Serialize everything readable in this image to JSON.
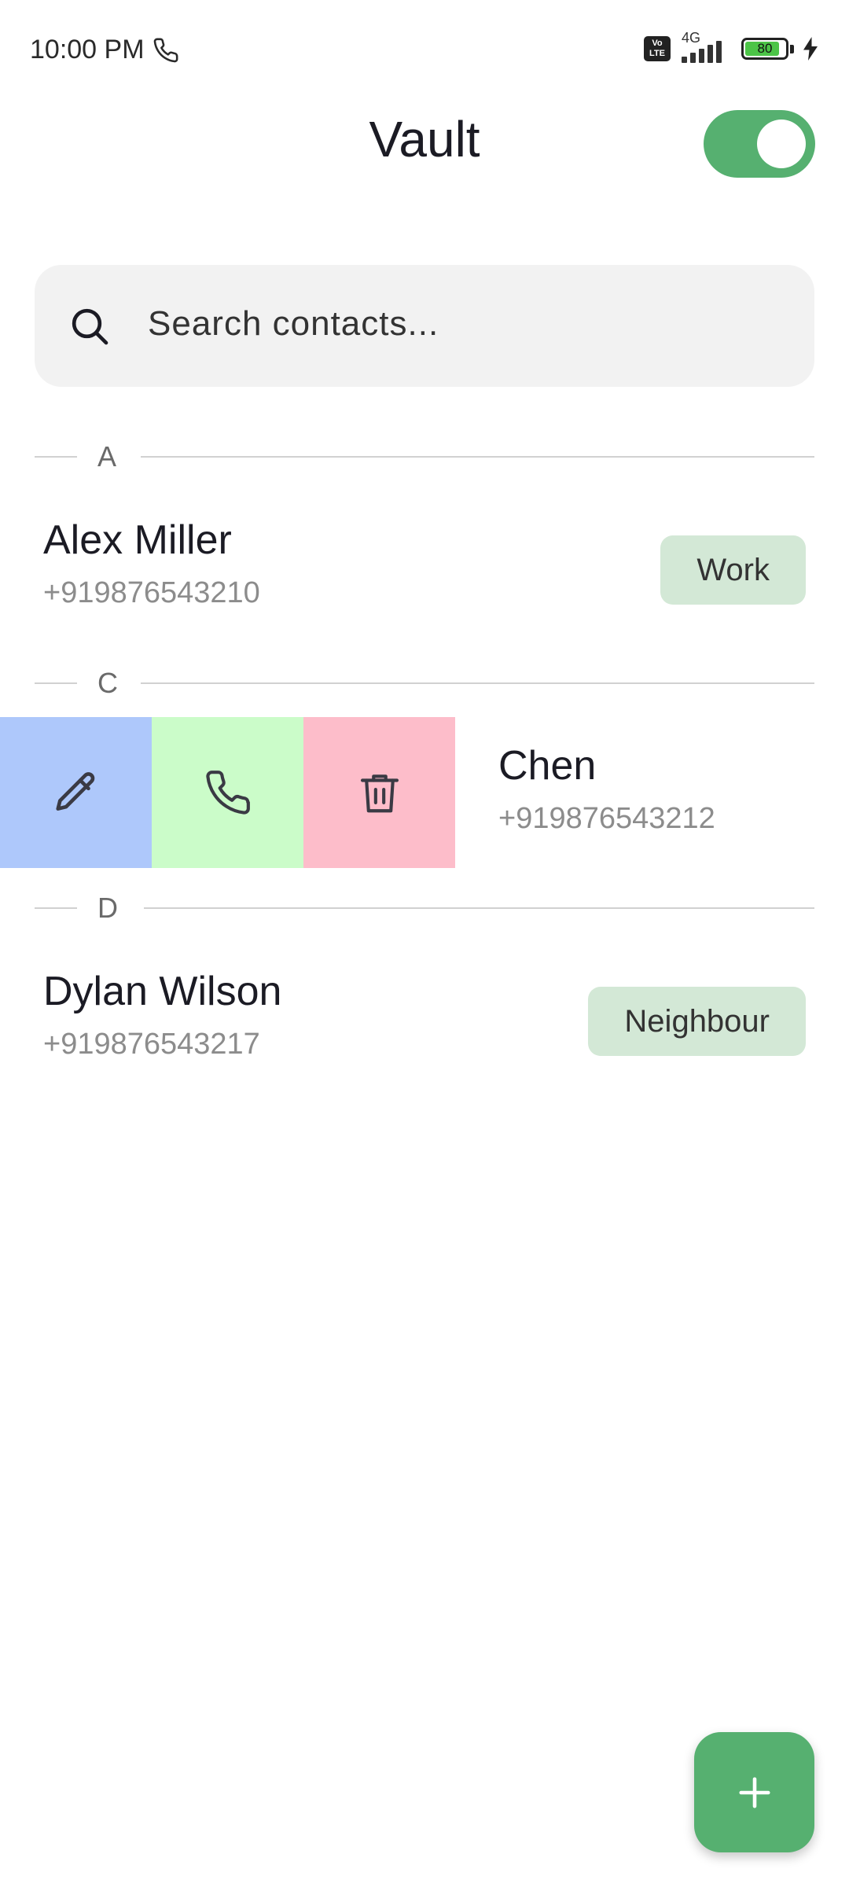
{
  "status_bar": {
    "time": "10:00 PM",
    "volte_label": "Vo LTE",
    "network": "4G",
    "battery_level": "80"
  },
  "header": {
    "title": "Vault",
    "toggle_on": true
  },
  "search": {
    "placeholder": "Search contacts..."
  },
  "sections": [
    {
      "letter": "A"
    },
    {
      "letter": "C"
    },
    {
      "letter": "D"
    }
  ],
  "contacts": [
    {
      "name": "Alex Miller",
      "phone": "+919876543210",
      "tag": "Work"
    },
    {
      "name": "Chen",
      "phone": "+919876543212",
      "tag": ""
    },
    {
      "name": "Dylan Wilson",
      "phone": "+919876543217",
      "tag": "Neighbour"
    }
  ],
  "swipe_actions": [
    {
      "icon": "pencil-icon",
      "color": "#aec8fb"
    },
    {
      "icon": "phone-icon",
      "color": "#cbfcc9"
    },
    {
      "icon": "trash-icon",
      "color": "#fdbdca"
    }
  ],
  "fab": {
    "icon": "plus-icon"
  },
  "colors": {
    "accent": "#56b070",
    "tag_bg": "#d3e8d6"
  }
}
